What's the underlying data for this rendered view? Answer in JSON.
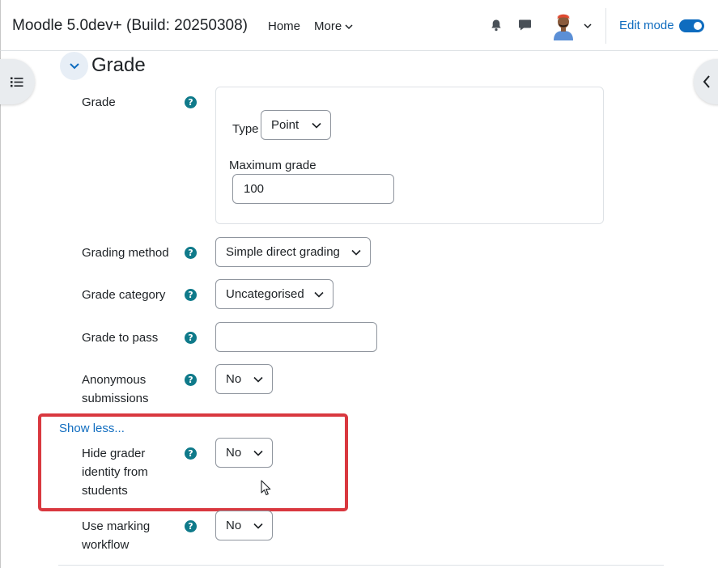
{
  "header": {
    "site_title": "Moodle 5.0dev+ (Build: 20250308)",
    "nav_home": "Home",
    "nav_more": "More",
    "edit_mode_label": "Edit mode",
    "edit_mode_on": true,
    "icons": [
      "bell-icon",
      "chat-icon",
      "avatar",
      "chevron-down-icon"
    ]
  },
  "section": {
    "title": "Grade",
    "expanded": true
  },
  "grade": {
    "label": "Grade",
    "type_label": "Type",
    "type_value": "Point",
    "max_grade_label": "Maximum grade",
    "max_grade_value": "100"
  },
  "grading_method": {
    "label": "Grading method",
    "value": "Simple direct grading"
  },
  "grade_category": {
    "label": "Grade category",
    "value": "Uncategorised"
  },
  "grade_to_pass": {
    "label": "Grade to pass",
    "value": ""
  },
  "anonymous": {
    "label": "Anonymous submissions",
    "value": "No"
  },
  "show_less": "Show less...",
  "hide_grader": {
    "label": "Hide grader identity from students",
    "value": "No"
  },
  "marking_workflow": {
    "label": "Use marking workflow",
    "value": "No"
  },
  "help_glyph": "?",
  "colors": {
    "accent": "#0f6cbf",
    "help": "#0f7a8a",
    "highlight": "#d9383f"
  }
}
